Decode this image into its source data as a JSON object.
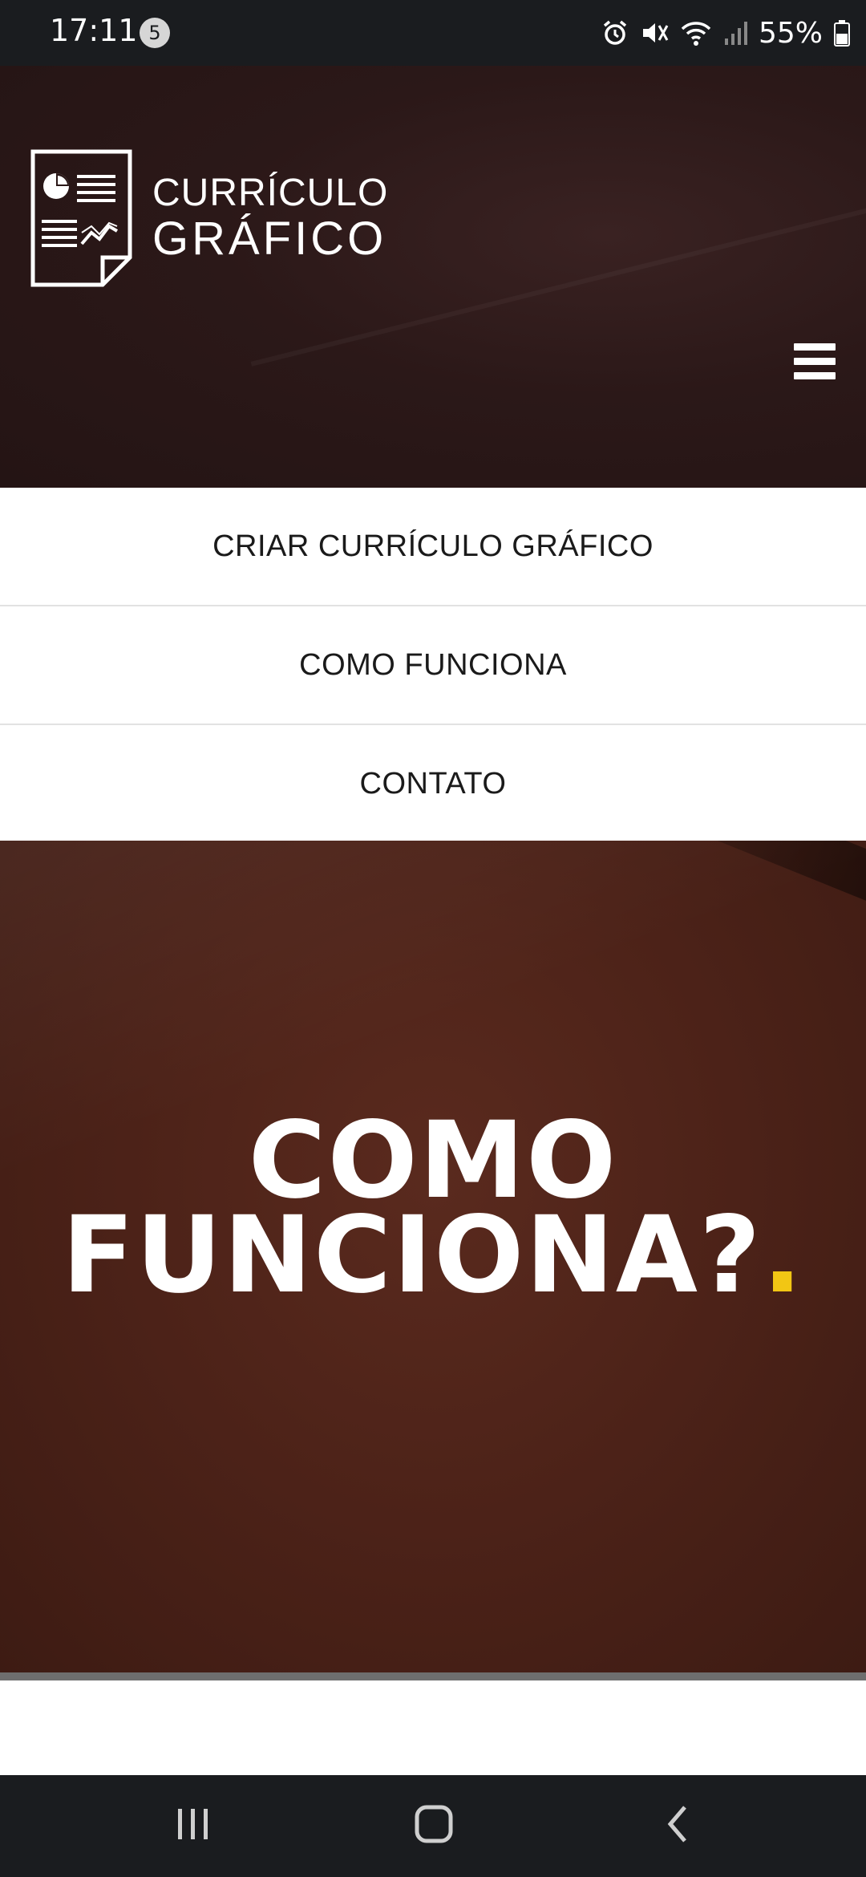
{
  "status_bar": {
    "time": "17:11",
    "notification_count": "5",
    "battery_percent": "55%"
  },
  "header": {
    "logo_line1": "CURRÍCULO",
    "logo_line2": "GRÁFICO"
  },
  "nav_menu": {
    "items": [
      {
        "label": "CRIAR CURRÍCULO GRÁFICO"
      },
      {
        "label": "COMO FUNCIONA"
      },
      {
        "label": "CONTATO"
      }
    ]
  },
  "hero": {
    "title_line1": "COMO",
    "title_line2": "FUNCIONA?",
    "title_dot": ".",
    "accent_color": "#f2c614"
  },
  "colors": {
    "header_bg": "#2b1818",
    "hero_bg": "#4c2218",
    "system_bar": "#1a1c1f"
  }
}
